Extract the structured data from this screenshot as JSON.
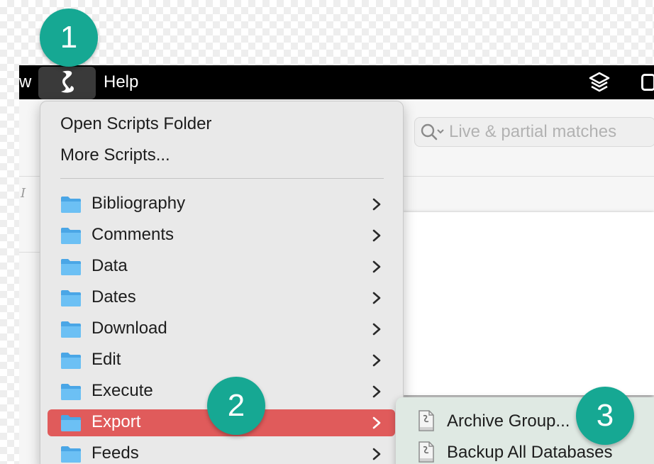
{
  "menubar": {
    "prev_item_partial": "w",
    "help_label": "Help",
    "script_menu_icon": "scroll-icon",
    "right_icons": [
      "layers-icon",
      "battery-icon"
    ]
  },
  "search": {
    "placeholder": "Live & partial matches"
  },
  "menu": {
    "top_items": [
      "Open Scripts Folder",
      "More Scripts..."
    ],
    "folders": [
      {
        "label": "Bibliography"
      },
      {
        "label": "Comments"
      },
      {
        "label": "Data"
      },
      {
        "label": "Dates"
      },
      {
        "label": "Download"
      },
      {
        "label": "Edit"
      },
      {
        "label": "Execute"
      },
      {
        "label": "Export",
        "selected": true
      },
      {
        "label": "Feeds"
      }
    ]
  },
  "submenu": {
    "items": [
      {
        "label": "Archive Group...",
        "icon": "script-bundle-icon"
      },
      {
        "label": "Backup All Databases",
        "icon": "script-bundle-icon"
      }
    ]
  },
  "badges": [
    "1",
    "2",
    "3"
  ],
  "colors": {
    "badge": "#16a893",
    "selected_item": "#e05b5b",
    "menubar": "#000000",
    "folder": "#5bb4ee"
  }
}
